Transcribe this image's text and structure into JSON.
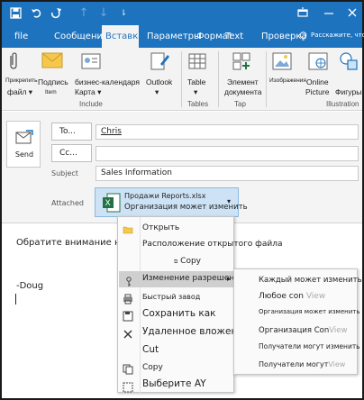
{
  "title_bar": {
    "quick_access": [
      "save-icon",
      "undo-icon",
      "redo-icon",
      "arrow-up-icon",
      "arrow-down-icon",
      "customize-icon"
    ],
    "window_buttons": [
      "restore-icon",
      "minimize-icon",
      "close-icon"
    ]
  },
  "tabs": {
    "file": "file",
    "message": "Сообщение",
    "insert": "Вставка",
    "options": "Параметры",
    "format": "Формат",
    "text": "Text",
    "review": "Проверка",
    "help": "Расскажите, что"
  },
  "ribbon": {
    "attach_file_top": "Прикрепить",
    "attach_file_bottom": "файл",
    "signature_top": "Подпись",
    "signature_bottom": "Item",
    "business_card_top": "бизнес-календаря",
    "business_card_bottom": "Карта",
    "outlook": "Outlook",
    "table": "Table",
    "element": "Элемент",
    "document": "документа",
    "images": "Изображения",
    "online": "Online",
    "picture": "Picture",
    "shapes": "Фигуры",
    "group_include": "Include",
    "group_tables": "Tables",
    "group_tap": "Tap",
    "group_illustrations": "Illustration"
  },
  "compose": {
    "send": "Send",
    "to_button": "To...",
    "cc_button": "Cc...",
    "subject_label": "Subject",
    "attached_label": "Attached",
    "to_value": "Chris",
    "cc_value": "",
    "subject_value": "Sales Information",
    "attachment_name": "Продажи Reports.xlsx",
    "attachment_sub": "Организация может изменить"
  },
  "body": {
    "line1": "Обратите внимание на",
    "line2": "-Doug"
  },
  "context_menu": {
    "open": "Открыть",
    "open_location": "Расположение открытого файла",
    "copy_small": "Copy",
    "change_permissions": "Изменение разрешений",
    "quick_print": "Быстрый завод",
    "save_as": "Сохранить как",
    "remove": "Удаленное вложение",
    "cut": "Cut",
    "copy": "Copy",
    "select_all": "Выберите AY"
  },
  "submenu": {
    "anyone_edit": "Каждый может изменить",
    "anyone_view_a": "Любое con",
    "anyone_view_b": "View",
    "org_edit": "Организация может изменить",
    "org_view_a": "Организация Con",
    "org_view_b": "View",
    "recipients_edit": "Получатели могут изменить",
    "recipients_view_a": "Получатели могут",
    "recipients_view_b": "View"
  },
  "colors": {
    "accent": "#1e73be",
    "ribbon_bg": "#f3f3f3",
    "chip_bg": "#cde3f5",
    "excel_green": "#217346"
  }
}
